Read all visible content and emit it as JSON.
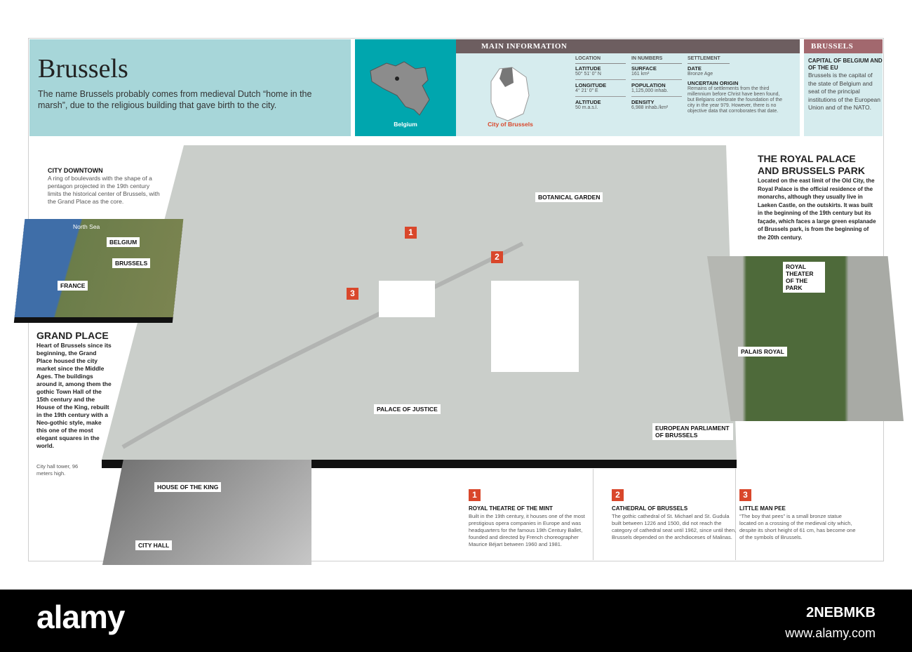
{
  "intro": {
    "title": "Brussels",
    "text": "The name Brussels probably comes from medieval Dutch “home in the marsh”, due to the religious building that gave birth to the city."
  },
  "locator": {
    "country": "Belgium",
    "city": "City of Brussels"
  },
  "main_info": {
    "header": "MAIN INFORMATION",
    "location": {
      "title": "LOCATION",
      "items": [
        {
          "k": "LATITUDE",
          "v": "50° 51' 0\" N"
        },
        {
          "k": "LONGITUDE",
          "v": "4° 21' 0\" E"
        },
        {
          "k": "ALTITUDE",
          "v": "50 m.a.s.l."
        }
      ]
    },
    "numbers": {
      "title": "IN NUMBERS",
      "items": [
        {
          "k": "SURFACE",
          "v": "161 km²"
        },
        {
          "k": "POPULATION",
          "v": "1,125,000 inhab."
        },
        {
          "k": "DENSITY",
          "v": "6,988 inhab./km²"
        }
      ]
    },
    "settlement": {
      "title": "SETTLEMENT",
      "date_k": "DATE",
      "date_v": "Bronze Age",
      "origin_k": "UNCERTAIN ORIGIN",
      "origin_v": "Remains of settlements from the third millennium before Christ have been found, but Belgians celebrate the foundation of the city in the year 979. However, there is no objective data that corroborates that date."
    }
  },
  "brussels_box": {
    "header": "BRUSSELS",
    "title": "CAPITAL OF BELGIUM AND OF THE EU",
    "text": "Brussels is the capital of the state of Belgium and seat of the principal institutions of the European Union and of the NATO."
  },
  "downtown": {
    "title": "CITY DOWNTOWN",
    "text": "A ring of boulevards with the shape of a pentagon projected in the 19th century limits the historical center of Brussels, with the Grand Place as the core."
  },
  "region_map": {
    "sea": "North Sea",
    "belgium": "BELGIUM",
    "brussels": "BRUSSELS",
    "france": "FRANCE"
  },
  "grand_place": {
    "title": "GRAND PLACE",
    "text": "Heart of Brussels since its beginning, the Grand Place housed the city market since the Middle Ages. The buildings around it, among them the gothic Town Hall of the 15th century and the House of the King, rebuilt in the 19th century with a Neo-gothic style, make this one of the most elegant squares in the world.",
    "caption": "City hall tower, 96 meters high."
  },
  "royal": {
    "title": "THE ROYAL PALACE AND BRUSSELS PARK",
    "text": "Located on the east limit of the Old City, the Royal Palace is the official residence of the monarchs, although they usually live in Laeken Castle, on the outskirts. It was built in the beginning of the 19th century but its façade, which faces a large green esplanade of Brussels park, is from the beginning of the 20th century."
  },
  "labels": {
    "botanical": "BOTANICAL GARDEN",
    "justice": "PALACE OF JUSTICE",
    "parliament": "EUROPEAN PARLIAMENT OF BRUSSELS",
    "theater": "ROYAL THEATER OF THE PARK",
    "palais": "PALAIS ROYAL",
    "king": "HOUSE OF THE KING",
    "cityhall": "CITY HALL"
  },
  "points": [
    {
      "n": "1",
      "title": "ROYAL THEATRE OF THE MINT",
      "text": "Built in the 19th century, it houses one of the most prestigious opera companies in Europe and was headquarters for the famous 19th Century Ballet, founded and directed by French choreographer Maurice Béjart between 1960 and 1981."
    },
    {
      "n": "2",
      "title": "CATHEDRAL OF BRUSSELS",
      "text": "The gothic cathedral of St. Michael and St. Gudula built between 1226 and 1500, did not reach the category of cathedral seat until 1962, since until then, Brussels depended on the archdioceses of Malinas."
    },
    {
      "n": "3",
      "title": "LITTLE MAN PEE",
      "text": "“The boy that pees” is a small bronze statue located on a crossing of the medieval city which, despite its short height of 61 cm, has become one of the symbols of Brussels."
    }
  ],
  "watermark": {
    "logo": "alamy",
    "id": "2NEBMKB",
    "url": "www.alamy.com"
  }
}
